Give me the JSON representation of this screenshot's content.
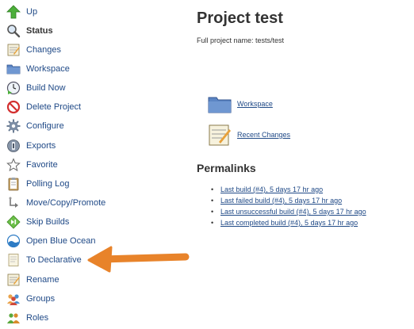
{
  "sidebar": {
    "items": [
      {
        "label": "Up",
        "icon": "up-arrow-icon"
      },
      {
        "label": "Status",
        "icon": "magnifier-icon"
      },
      {
        "label": "Changes",
        "icon": "notepad-icon"
      },
      {
        "label": "Workspace",
        "icon": "folder-icon"
      },
      {
        "label": "Build Now",
        "icon": "clock-play-icon"
      },
      {
        "label": "Delete Project",
        "icon": "no-entry-icon"
      },
      {
        "label": "Configure",
        "icon": "gear-icon"
      },
      {
        "label": "Exports",
        "icon": "exports-icon"
      },
      {
        "label": "Favorite",
        "icon": "star-icon"
      },
      {
        "label": "Polling Log",
        "icon": "clipboard-icon"
      },
      {
        "label": "Move/Copy/Promote",
        "icon": "move-icon"
      },
      {
        "label": "Skip Builds",
        "icon": "skip-icon"
      },
      {
        "label": "Open Blue Ocean",
        "icon": "blue-ocean-icon"
      },
      {
        "label": "To Declarative",
        "icon": "document-icon"
      },
      {
        "label": "Rename",
        "icon": "notepad-icon"
      },
      {
        "label": "Groups",
        "icon": "group-icon"
      },
      {
        "label": "Roles",
        "icon": "roles-icon"
      }
    ]
  },
  "main": {
    "title": "Project test",
    "full_name": "Full project name: tests/test",
    "links": [
      {
        "label": "Workspace",
        "icon": "folder-icon"
      },
      {
        "label": "Recent Changes",
        "icon": "notepad-icon"
      }
    ],
    "permalinks_title": "Permalinks",
    "permalinks": [
      "Last build (#4), 5 days 17 hr ago",
      "Last failed build (#4), 5 days 17 hr ago",
      "Last unsuccessful build (#4), 5 days 17 hr ago",
      "Last completed build (#4), 5 days 17 hr ago"
    ]
  },
  "annotation": {
    "color": "#e8832a"
  }
}
